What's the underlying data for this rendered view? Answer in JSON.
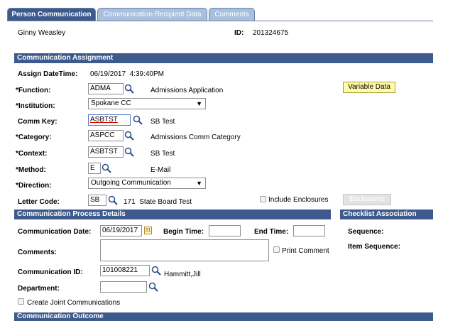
{
  "tabs": [
    {
      "label": "Person Communication"
    },
    {
      "label": "Communication Recipient Data"
    },
    {
      "label": "Comments"
    }
  ],
  "person": {
    "name": "Ginny Weasley",
    "id_label": "ID:",
    "id_value": "201324675"
  },
  "assignment": {
    "section_title": "Communication Assignment",
    "assign_datetime_label": "Assign DateTime:",
    "assign_datetime_value": "06/19/2017  4:39:40PM",
    "function_label": "*Function:",
    "function_value": "ADMA",
    "function_desc": "Admissions Application",
    "variable_data_button": "Variable Data",
    "institution_label": "*Institution:",
    "institution_value": "Spokane CC",
    "comm_key_label": "Comm Key:",
    "comm_key_value": "ASBTST",
    "comm_key_desc": "SB Test",
    "category_label": "*Category:",
    "category_value": "ASPCC",
    "category_desc": "Admissions Comm Category",
    "context_label": "*Context:",
    "context_value": "ASBTST",
    "context_desc": "SB Test",
    "method_label": "*Method:",
    "method_value": "E",
    "method_desc": "E-Mail",
    "direction_label": "*Direction:",
    "direction_value": "Outgoing Communication",
    "letter_code_label": "Letter Code:",
    "letter_code_value": "SB",
    "letter_code_desc": "171  State Board Test",
    "include_enclosures_label": "Include Enclosures",
    "enclosures_button": "Enclosures"
  },
  "process": {
    "section_title": "Communication Process Details",
    "comm_date_label": "Communication Date:",
    "comm_date_value": "06/19/2017",
    "calendar_glyph": "31",
    "begin_time_label": "Begin Time:",
    "begin_time_value": "",
    "end_time_label": "End Time:",
    "end_time_value": "",
    "comments_label": "Comments:",
    "print_comment_label": "Print Comment",
    "comm_id_label": "Communication ID:",
    "comm_id_value": "101008221",
    "comm_id_name": "Hammitt,Jill",
    "department_label": "Department:",
    "department_value": "",
    "joint_comm_label": "Create Joint Communications"
  },
  "checklist": {
    "section_title": "Checklist Association",
    "sequence_label": "Sequence:",
    "item_sequence_label": "Item Sequence:"
  },
  "outcome": {
    "section_title": "Communication Outcome"
  },
  "colors": {
    "section_bg": "#3d5a8c",
    "tab_inactive": "#a8c0de",
    "button_yellow": "#fffca8"
  },
  "icons": {
    "lookup": "magnifier-icon",
    "calendar": "calendar-icon"
  }
}
